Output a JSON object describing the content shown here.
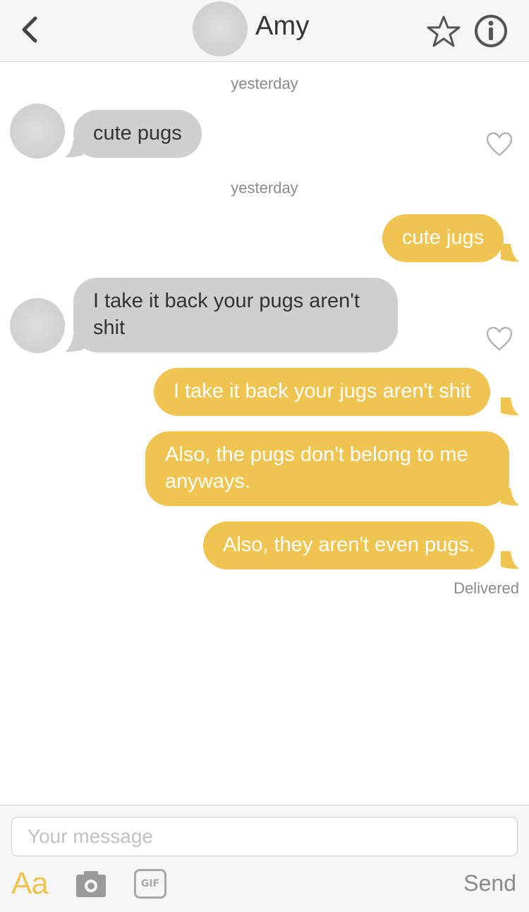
{
  "header": {
    "contact_name": "Amy",
    "back_icon": "chevron-left-icon",
    "star_icon": "star-outline-icon",
    "info_icon": "info-circle-icon"
  },
  "conversation": {
    "timestamps": [
      "yesterday",
      "yesterday"
    ],
    "messages": [
      {
        "direction": "incoming",
        "text": "cute pugs"
      },
      {
        "direction": "outgoing",
        "text": "cute jugs"
      },
      {
        "direction": "incoming",
        "text": "I take it back your pugs aren't shit"
      },
      {
        "direction": "outgoing",
        "text": "I take it back your jugs aren't shit"
      },
      {
        "direction": "outgoing",
        "text": "Also, the pugs don't belong to me anyways."
      },
      {
        "direction": "outgoing",
        "text": "Also, they aren't even pugs."
      }
    ],
    "status": "Delivered"
  },
  "composer": {
    "placeholder": "Your message",
    "value": "",
    "format_label": "Aa",
    "gif_label": "GIF",
    "send_label": "Send"
  },
  "colors": {
    "outgoing_bubble": "#efc450",
    "incoming_bubble": "#cfcfcf",
    "accent": "#efc450"
  }
}
